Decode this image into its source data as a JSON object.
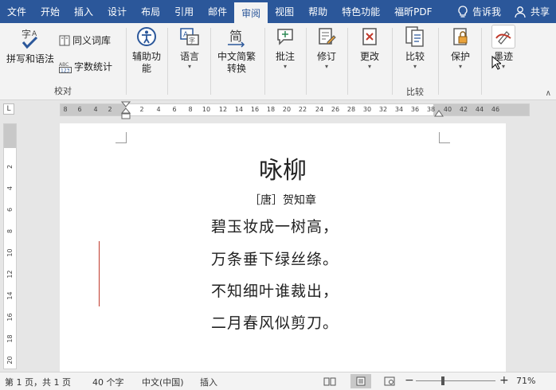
{
  "menubar": {
    "tabs": [
      "文件",
      "开始",
      "插入",
      "设计",
      "布局",
      "引用",
      "邮件",
      "审阅",
      "视图",
      "帮助",
      "特色功能",
      "福昕PDF"
    ],
    "active": "审阅",
    "tell_me": "告诉我",
    "share": "共享"
  },
  "ribbon": {
    "proofing": {
      "spelling": "拼写和语法",
      "thesaurus": "同义词库",
      "word_count": "字数统计",
      "group_label": "校对"
    },
    "accessibility": {
      "line1": "辅助功",
      "line2": "能"
    },
    "language": {
      "label": "语言"
    },
    "chinese": {
      "line1": "中文简繁",
      "line2": "转换"
    },
    "comments": {
      "label": "批注"
    },
    "tracking": {
      "label": "修订"
    },
    "changes": {
      "label": "更改"
    },
    "compare": {
      "label": "比较",
      "group_label": "比较"
    },
    "protect": {
      "label": "保护"
    },
    "ink": {
      "label": "墨迹"
    }
  },
  "ruler": {
    "left_numbers": [
      "8",
      "6",
      "4",
      "2"
    ],
    "main_numbers": [
      "2",
      "4",
      "6",
      "8",
      "10",
      "12",
      "14",
      "16",
      "18",
      "20",
      "22",
      "24",
      "26",
      "28",
      "30",
      "32",
      "34",
      "36",
      "38"
    ],
    "right_numbers": [
      "40",
      "42",
      "44",
      "46"
    ],
    "vertical_numbers": [
      "2",
      "4",
      "6",
      "8",
      "10",
      "12",
      "14",
      "16",
      "18",
      "20"
    ]
  },
  "document": {
    "title": "咏柳",
    "author": "［唐］贺知章",
    "lines": [
      "碧玉妆成一树高，",
      "万条垂下绿丝绦。",
      "不知细叶谁裁出，",
      "二月春风似剪刀。"
    ]
  },
  "status": {
    "page": "第 1 页，共 1 页",
    "words": "40 个字",
    "language": "中文(中国)",
    "mode": "插入",
    "zoom": "71%",
    "zoom_level": 0.71
  },
  "colors": {
    "accent": "#2b579a",
    "ribbon_bg": "#f3f3f3",
    "change_bar": "#c0392b"
  }
}
